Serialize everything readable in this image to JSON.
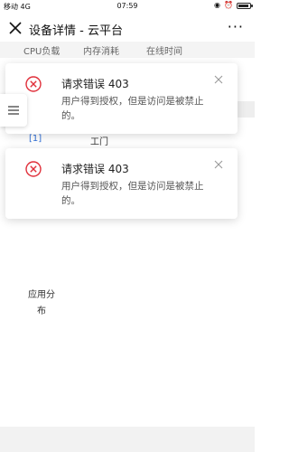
{
  "status_bar": {
    "carrier": "移动 4G",
    "time": "07:59",
    "right_icons": [
      "wechat-icon",
      "alarm-icon",
      "battery-icon"
    ]
  },
  "navbar": {
    "title": "设备详情 - 云平台",
    "close_icon": "close-icon",
    "more_label": "···"
  },
  "tabs": [
    "CPU负载",
    "内存消耗",
    "在线时间"
  ],
  "background": {
    "left_fragment": "[1]",
    "mid_fragment": "工门",
    "app_distribution": "应用分布"
  },
  "toasts": [
    {
      "title": "请求错误 403",
      "message": "用户得到授权，但是访问是被禁止的。",
      "icon": "error-circle-icon",
      "close_icon": "close-icon"
    },
    {
      "title": "请求错误 403",
      "message": "用户得到授权，但是访问是被禁止的。",
      "icon": "error-circle-icon",
      "close_icon": "close-icon"
    }
  ],
  "colors": {
    "error": "#e02f3a",
    "link": "#2f6fd6"
  }
}
